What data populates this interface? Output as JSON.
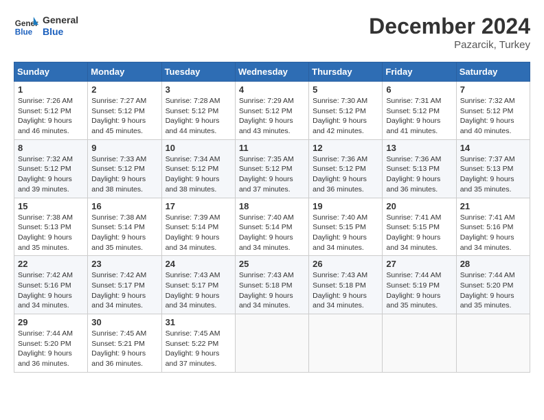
{
  "header": {
    "logo_general": "General",
    "logo_blue": "Blue",
    "month_title": "December 2024",
    "location": "Pazarcik, Turkey"
  },
  "weekdays": [
    "Sunday",
    "Monday",
    "Tuesday",
    "Wednesday",
    "Thursday",
    "Friday",
    "Saturday"
  ],
  "weeks": [
    [
      {
        "day": "1",
        "sunrise": "7:26 AM",
        "sunset": "5:12 PM",
        "daylight": "9 hours and 46 minutes."
      },
      {
        "day": "2",
        "sunrise": "7:27 AM",
        "sunset": "5:12 PM",
        "daylight": "9 hours and 45 minutes."
      },
      {
        "day": "3",
        "sunrise": "7:28 AM",
        "sunset": "5:12 PM",
        "daylight": "9 hours and 44 minutes."
      },
      {
        "day": "4",
        "sunrise": "7:29 AM",
        "sunset": "5:12 PM",
        "daylight": "9 hours and 43 minutes."
      },
      {
        "day": "5",
        "sunrise": "7:30 AM",
        "sunset": "5:12 PM",
        "daylight": "9 hours and 42 minutes."
      },
      {
        "day": "6",
        "sunrise": "7:31 AM",
        "sunset": "5:12 PM",
        "daylight": "9 hours and 41 minutes."
      },
      {
        "day": "7",
        "sunrise": "7:32 AM",
        "sunset": "5:12 PM",
        "daylight": "9 hours and 40 minutes."
      }
    ],
    [
      {
        "day": "8",
        "sunrise": "7:32 AM",
        "sunset": "5:12 PM",
        "daylight": "9 hours and 39 minutes."
      },
      {
        "day": "9",
        "sunrise": "7:33 AM",
        "sunset": "5:12 PM",
        "daylight": "9 hours and 38 minutes."
      },
      {
        "day": "10",
        "sunrise": "7:34 AM",
        "sunset": "5:12 PM",
        "daylight": "9 hours and 38 minutes."
      },
      {
        "day": "11",
        "sunrise": "7:35 AM",
        "sunset": "5:12 PM",
        "daylight": "9 hours and 37 minutes."
      },
      {
        "day": "12",
        "sunrise": "7:36 AM",
        "sunset": "5:12 PM",
        "daylight": "9 hours and 36 minutes."
      },
      {
        "day": "13",
        "sunrise": "7:36 AM",
        "sunset": "5:13 PM",
        "daylight": "9 hours and 36 minutes."
      },
      {
        "day": "14",
        "sunrise": "7:37 AM",
        "sunset": "5:13 PM",
        "daylight": "9 hours and 35 minutes."
      }
    ],
    [
      {
        "day": "15",
        "sunrise": "7:38 AM",
        "sunset": "5:13 PM",
        "daylight": "9 hours and 35 minutes."
      },
      {
        "day": "16",
        "sunrise": "7:38 AM",
        "sunset": "5:14 PM",
        "daylight": "9 hours and 35 minutes."
      },
      {
        "day": "17",
        "sunrise": "7:39 AM",
        "sunset": "5:14 PM",
        "daylight": "9 hours and 34 minutes."
      },
      {
        "day": "18",
        "sunrise": "7:40 AM",
        "sunset": "5:14 PM",
        "daylight": "9 hours and 34 minutes."
      },
      {
        "day": "19",
        "sunrise": "7:40 AM",
        "sunset": "5:15 PM",
        "daylight": "9 hours and 34 minutes."
      },
      {
        "day": "20",
        "sunrise": "7:41 AM",
        "sunset": "5:15 PM",
        "daylight": "9 hours and 34 minutes."
      },
      {
        "day": "21",
        "sunrise": "7:41 AM",
        "sunset": "5:16 PM",
        "daylight": "9 hours and 34 minutes."
      }
    ],
    [
      {
        "day": "22",
        "sunrise": "7:42 AM",
        "sunset": "5:16 PM",
        "daylight": "9 hours and 34 minutes."
      },
      {
        "day": "23",
        "sunrise": "7:42 AM",
        "sunset": "5:17 PM",
        "daylight": "9 hours and 34 minutes."
      },
      {
        "day": "24",
        "sunrise": "7:43 AM",
        "sunset": "5:17 PM",
        "daylight": "9 hours and 34 minutes."
      },
      {
        "day": "25",
        "sunrise": "7:43 AM",
        "sunset": "5:18 PM",
        "daylight": "9 hours and 34 minutes."
      },
      {
        "day": "26",
        "sunrise": "7:43 AM",
        "sunset": "5:18 PM",
        "daylight": "9 hours and 34 minutes."
      },
      {
        "day": "27",
        "sunrise": "7:44 AM",
        "sunset": "5:19 PM",
        "daylight": "9 hours and 35 minutes."
      },
      {
        "day": "28",
        "sunrise": "7:44 AM",
        "sunset": "5:20 PM",
        "daylight": "9 hours and 35 minutes."
      }
    ],
    [
      {
        "day": "29",
        "sunrise": "7:44 AM",
        "sunset": "5:20 PM",
        "daylight": "9 hours and 36 minutes."
      },
      {
        "day": "30",
        "sunrise": "7:45 AM",
        "sunset": "5:21 PM",
        "daylight": "9 hours and 36 minutes."
      },
      {
        "day": "31",
        "sunrise": "7:45 AM",
        "sunset": "5:22 PM",
        "daylight": "9 hours and 37 minutes."
      },
      null,
      null,
      null,
      null
    ]
  ],
  "labels": {
    "sunrise": "Sunrise:",
    "sunset": "Sunset:",
    "daylight": "Daylight:"
  }
}
